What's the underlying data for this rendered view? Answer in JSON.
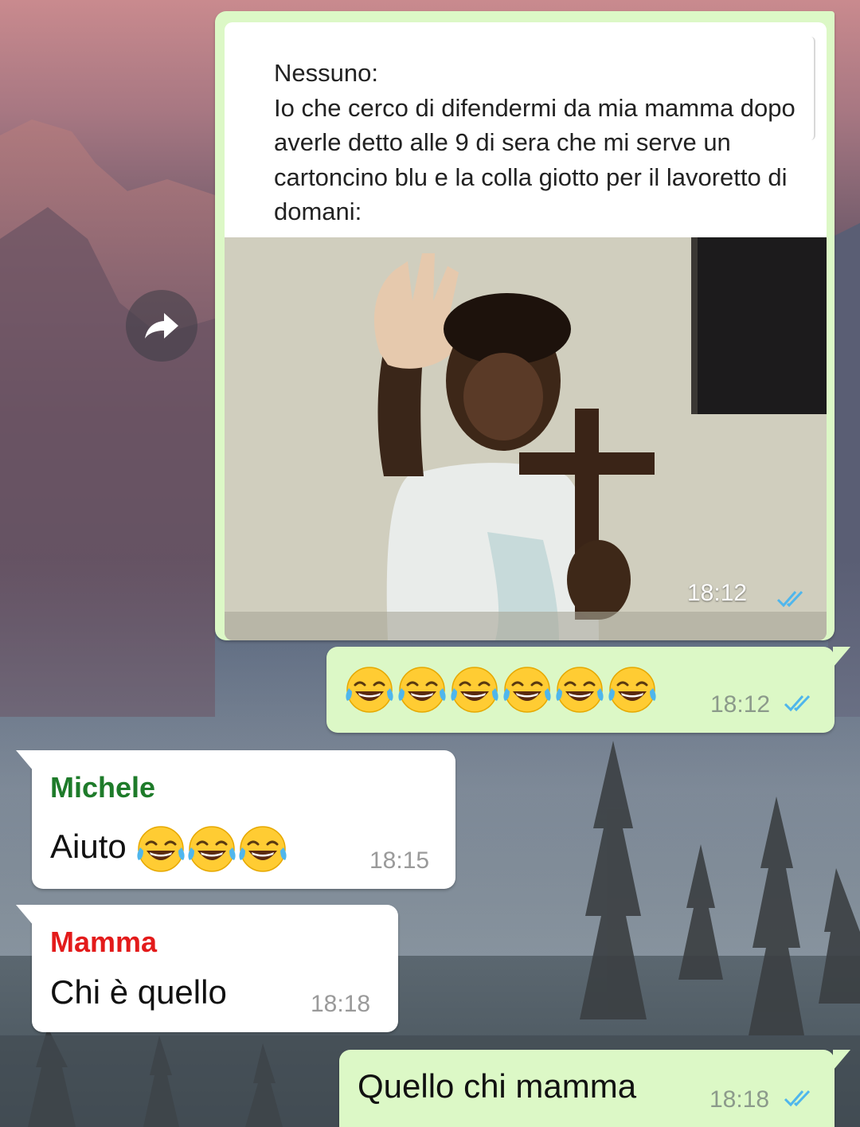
{
  "colors": {
    "outgoing_bubble": "#dcf8c6",
    "incoming_bubble": "#ffffff",
    "read_ticks": "#4fb6ec",
    "sender_michele": "#1e7b2a",
    "sender_mamma": "#e31b1b"
  },
  "messages": [
    {
      "direction": "outgoing",
      "type": "forwarded-image-card",
      "card_text": "Nessuno:\nIo che cerco di difendermi da mia mamma dopo averle detto alle 9 di sera che mi serve un cartoncino blu e la colla giotto per il lavoretto di domani:",
      "image": "meme-photo-boy-with-cross",
      "time": "18:12",
      "status_icon": "double-check-icon"
    },
    {
      "direction": "outgoing",
      "type": "text",
      "emojis": [
        "tears-of-joy-emoji",
        "tears-of-joy-emoji",
        "tears-of-joy-emoji",
        "tears-of-joy-emoji",
        "tears-of-joy-emoji",
        "tears-of-joy-emoji"
      ],
      "time": "18:12",
      "status_icon": "double-check-icon"
    },
    {
      "direction": "incoming",
      "sender": "Michele",
      "text": "Aiuto",
      "emojis": [
        "tears-of-joy-emoji",
        "tears-of-joy-emoji",
        "tears-of-joy-emoji"
      ],
      "time": "18:15"
    },
    {
      "direction": "incoming",
      "sender": "Mamma",
      "text": "Chi è quello",
      "time": "18:18"
    },
    {
      "direction": "outgoing",
      "type": "text",
      "text": "Quello chi mamma",
      "time": "18:18",
      "status_icon": "double-check-icon"
    }
  ],
  "forward_button": {
    "icon": "forward-arrow-icon"
  }
}
